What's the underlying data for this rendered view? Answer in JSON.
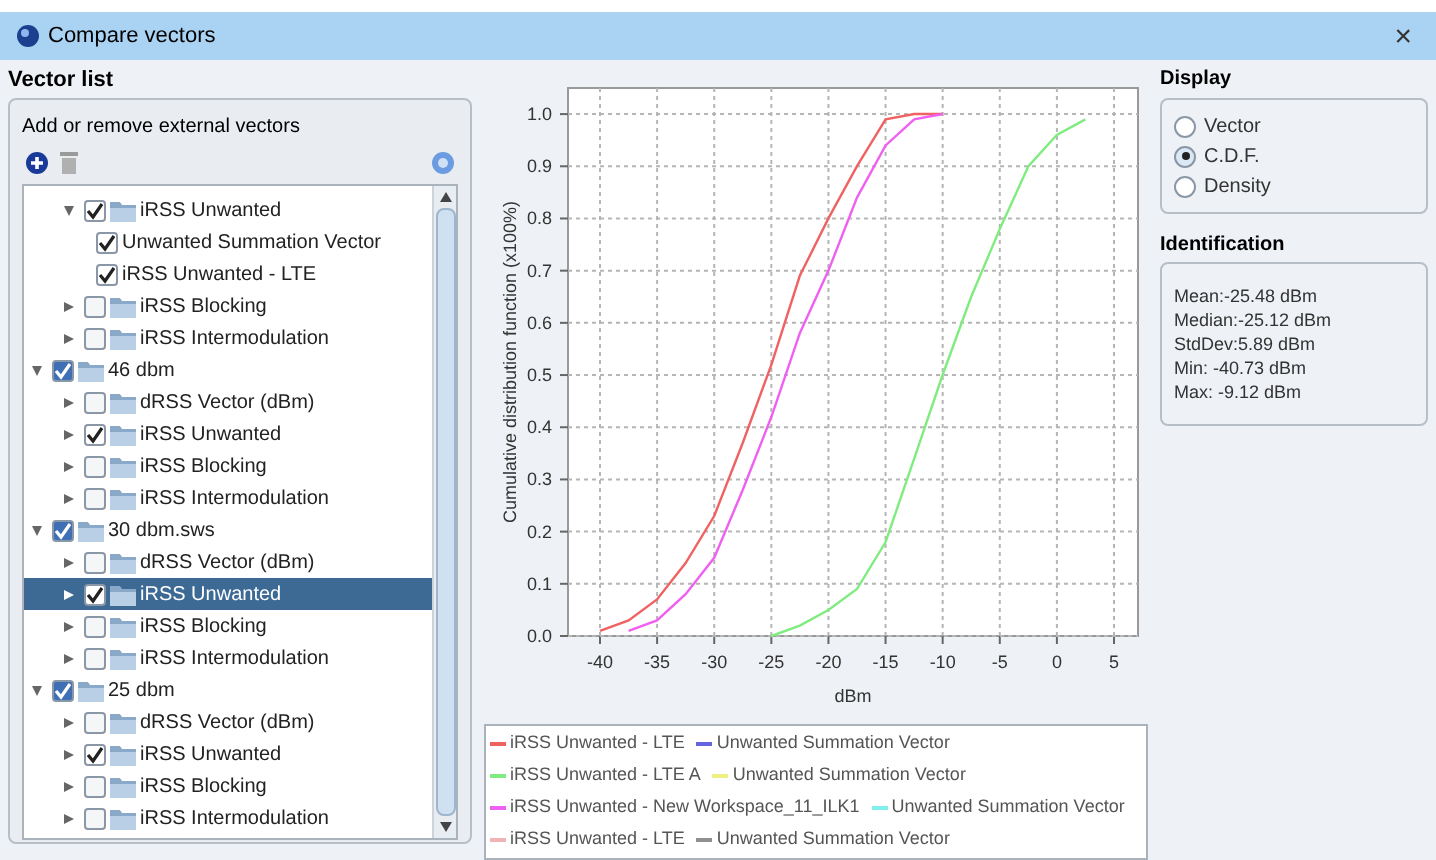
{
  "window": {
    "title": "Compare vectors",
    "close": "×"
  },
  "vector_list": {
    "title": "Vector list",
    "subtitle": "Add or remove external vectors"
  },
  "tree": {
    "partial_items": [
      {
        "label": "iRSS Unwanted",
        "kind": "folder",
        "checked": true,
        "expanded": true,
        "selected": false,
        "children": [
          {
            "label": "Unwanted Summation Vector",
            "kind": "vector",
            "checked": true,
            "selected": false
          },
          {
            "label": "iRSS Unwanted - LTE",
            "kind": "vector",
            "checked": true,
            "selected": false
          }
        ]
      },
      {
        "label": "iRSS Blocking",
        "kind": "folder",
        "checked": false,
        "expanded": false,
        "selected": false
      },
      {
        "label": "iRSS Intermodulation",
        "kind": "folder",
        "checked": false,
        "expanded": false,
        "selected": false
      }
    ],
    "items": [
      {
        "label": "46 dbm",
        "kind": "folder",
        "checked": true,
        "expanded": true,
        "selected": false,
        "children": [
          {
            "label": "dRSS Vector (dBm)",
            "kind": "folder",
            "checked": false,
            "expanded": false,
            "selected": false
          },
          {
            "label": "iRSS Unwanted",
            "kind": "folder",
            "checked": true,
            "expanded": false,
            "selected": false
          },
          {
            "label": "iRSS Blocking",
            "kind": "folder",
            "checked": false,
            "expanded": false,
            "selected": false
          },
          {
            "label": "iRSS Intermodulation",
            "kind": "folder",
            "checked": false,
            "expanded": false,
            "selected": false
          }
        ]
      },
      {
        "label": "30 dbm.sws",
        "kind": "folder",
        "checked": true,
        "expanded": true,
        "selected": false,
        "children": [
          {
            "label": "dRSS Vector (dBm)",
            "kind": "folder",
            "checked": false,
            "expanded": false,
            "selected": false
          },
          {
            "label": "iRSS Unwanted",
            "kind": "folder",
            "checked": true,
            "expanded": false,
            "selected": true
          },
          {
            "label": "iRSS Blocking",
            "kind": "folder",
            "checked": false,
            "expanded": false,
            "selected": false
          },
          {
            "label": "iRSS Intermodulation",
            "kind": "folder",
            "checked": false,
            "expanded": false,
            "selected": false
          }
        ]
      },
      {
        "label": "25 dbm",
        "kind": "folder",
        "checked": true,
        "expanded": true,
        "selected": false,
        "children": [
          {
            "label": "dRSS Vector (dBm)",
            "kind": "folder",
            "checked": false,
            "expanded": false,
            "selected": false
          },
          {
            "label": "iRSS Unwanted",
            "kind": "folder",
            "checked": true,
            "expanded": false,
            "selected": false
          },
          {
            "label": "iRSS Blocking",
            "kind": "folder",
            "checked": false,
            "expanded": false,
            "selected": false
          },
          {
            "label": "iRSS Intermodulation",
            "kind": "folder",
            "checked": false,
            "expanded": false,
            "selected": false
          }
        ]
      }
    ]
  },
  "chart": {
    "chart_data": {
      "type": "line",
      "xlabel": "dBm",
      "ylabel": "Cumulative distribution function (x100%)",
      "grid": true,
      "x": [
        -40,
        -37.5,
        -35,
        -32.5,
        -30,
        -27.5,
        -25,
        -22.5,
        -20,
        -17.5,
        -15,
        -12.5,
        -10,
        -7.5,
        -5,
        -2.5,
        0,
        2.5
      ],
      "series": [
        {
          "color": "#f06262",
          "values": [
            0.01,
            0.03,
            0.07,
            0.14,
            0.23,
            0.37,
            0.52,
            0.69,
            0.8,
            0.9,
            0.99,
            1.0,
            1.0,
            null,
            null,
            null,
            null,
            null
          ]
        },
        {
          "color": "#f060f0",
          "values": [
            null,
            0.01,
            0.03,
            0.08,
            0.15,
            0.28,
            0.42,
            0.58,
            0.7,
            0.84,
            0.94,
            0.99,
            1.0,
            null,
            null,
            null,
            null,
            null
          ]
        },
        {
          "color": "#80ec80",
          "values": [
            null,
            null,
            null,
            null,
            null,
            null,
            0.0,
            0.02,
            0.05,
            0.09,
            0.18,
            0.34,
            0.5,
            0.65,
            0.78,
            0.9,
            0.96,
            0.99
          ]
        }
      ],
      "xlim": [
        -42.8,
        7.1
      ],
      "ylim": [
        0,
        1.05
      ],
      "xticks": [
        -40,
        -35,
        -30,
        -25,
        -20,
        -15,
        -10,
        -5,
        0,
        5
      ],
      "yticks": [
        {
          "value": 0,
          "label": "0.0"
        },
        {
          "value": 0.1,
          "label": "0.1"
        },
        {
          "value": 0.2,
          "label": "0.2"
        },
        {
          "value": 0.3,
          "label": "0.3"
        },
        {
          "value": 0.4,
          "label": "0.4"
        },
        {
          "value": 0.5,
          "label": "0.5"
        },
        {
          "value": 0.6,
          "label": "0.6"
        },
        {
          "value": 0.7,
          "label": "0.7"
        },
        {
          "value": 0.8,
          "label": "0.8"
        },
        {
          "value": 0.9,
          "label": "0.9"
        },
        {
          "value": 1,
          "label": "1.0"
        }
      ]
    }
  },
  "legend": [
    {
      "label": "iRSS Unwanted - LTE",
      "color": "#f06262"
    },
    {
      "label": "Unwanted Summation Vector",
      "color": "#6464e0"
    },
    {
      "label": "iRSS Unwanted - LTE A",
      "color": "#80ec80"
    },
    {
      "label": "Unwanted Summation Vector",
      "color": "#f0f080"
    },
    {
      "label": "iRSS Unwanted - New Workspace_11_ILK1",
      "color": "#f060f0"
    },
    {
      "label": "Unwanted Summation Vector",
      "color": "#80f0f0"
    },
    {
      "label": "iRSS Unwanted - LTE",
      "color": "#f0b4b4"
    },
    {
      "label": "Unwanted Summation Vector",
      "color": "#909090"
    }
  ],
  "display": {
    "title": "Display",
    "options": [
      {
        "label": "Vector",
        "selected": false
      },
      {
        "label": "C.D.F.",
        "selected": true
      },
      {
        "label": "Density",
        "selected": false
      }
    ]
  },
  "identification": {
    "title": "Identification",
    "lines": [
      "Mean:-25.48 dBm",
      "Median:-25.12 dBm",
      "StdDev:5.89 dBm",
      "Min: -40.73 dBm",
      "Max: -9.12 dBm"
    ]
  }
}
